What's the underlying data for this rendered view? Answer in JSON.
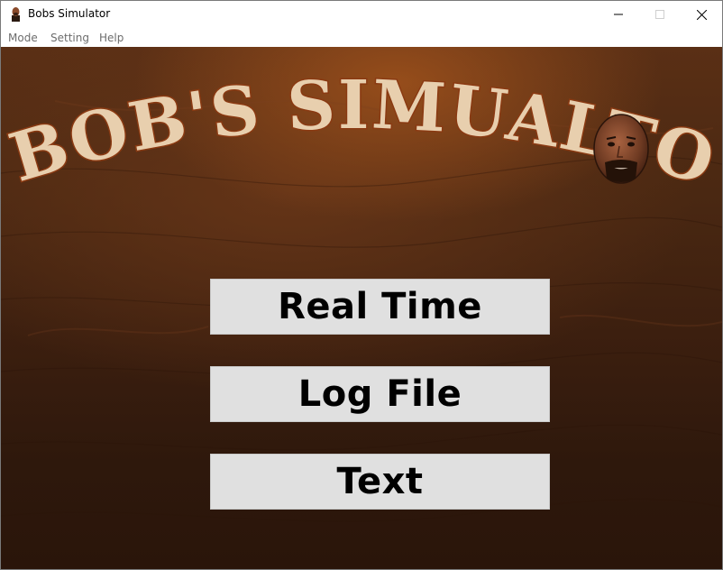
{
  "window": {
    "title": "Bobs Simulator",
    "icon": "bob-portrait-icon"
  },
  "menubar": {
    "items": [
      {
        "label": "Mode"
      },
      {
        "label": "Setting"
      },
      {
        "label": "Help"
      }
    ]
  },
  "logo": {
    "text": "BOB'S SIMUALTOR",
    "colors": {
      "letter_fill": "#e8cfae",
      "letter_outline": "#8a3a12"
    }
  },
  "buttons": {
    "real_time": "Real Time",
    "log_file": "Log File",
    "text": "Text"
  },
  "colors": {
    "background_wood": "#4a2812",
    "button_bg": "#e0e0e0",
    "button_text": "#000000"
  }
}
